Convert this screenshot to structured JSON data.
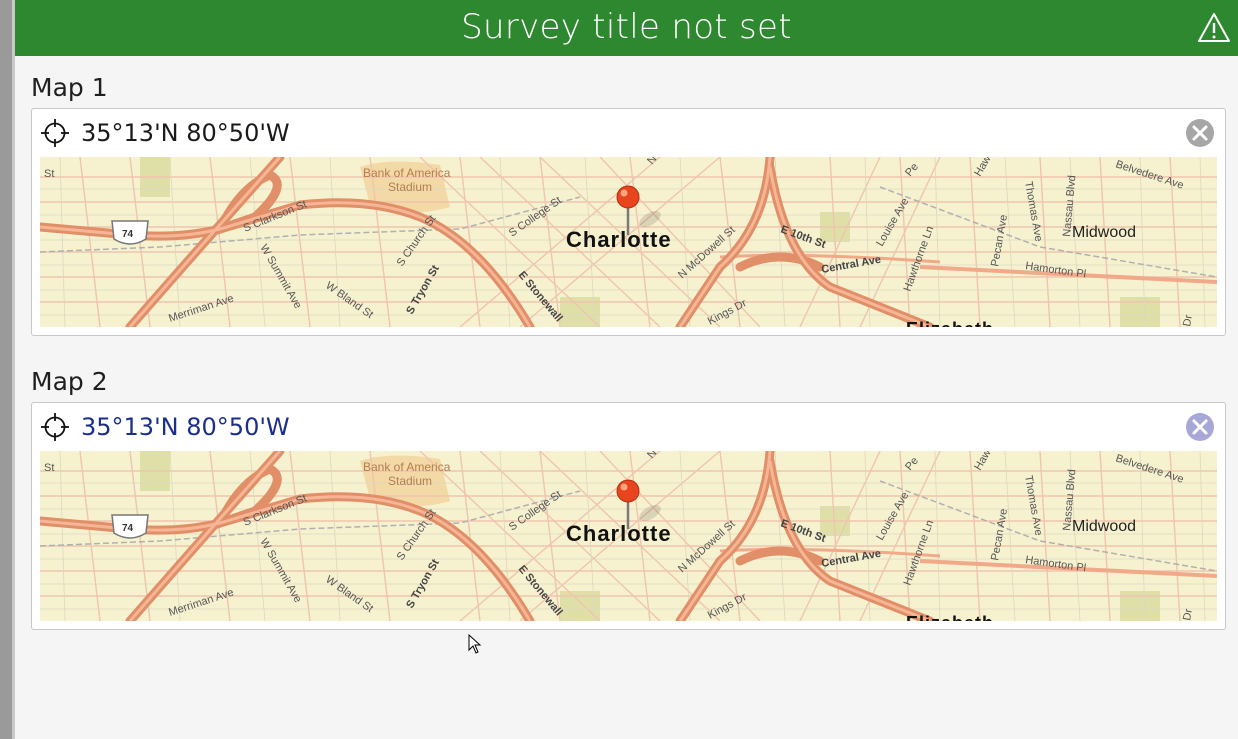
{
  "header": {
    "title": "Survey title not set",
    "warning_icon": "warning-triangle-icon"
  },
  "questions": [
    {
      "label": "Map 1",
      "coordinate": "35°13'N 80°50'W",
      "coord_color": "#1a1a1a",
      "clear_icon_color": "#a6a6a6"
    },
    {
      "label": "Map 2",
      "coordinate": "35°13'N 80°50'W",
      "coord_color": "#1b2e8c",
      "clear_icon_color": "#a8a8d8"
    }
  ],
  "map": {
    "city": "Charlotte",
    "neighborhood": "Midwood",
    "poi_line1": "Bank of America",
    "poi_line2": "Stadium",
    "shield": "74",
    "partial_label": "Elizabeth",
    "road_labels": [
      "S Clarkson St",
      "W Summit Ave",
      "W Bland St",
      "S Tryon St",
      "S Church St",
      "S College St",
      "E Stonewall",
      "N McDowell St",
      "E 10th St",
      "N Br",
      "Central Ave",
      "Louise Ave",
      "Hawthorne Ln",
      "Pecan Ave",
      "Thomas Ave",
      "Nassau Blvd",
      "Hamorton Pl",
      "Belvedere Ave",
      "Kings Dr",
      "Merriman Ave",
      "Pe",
      "Hawt",
      "Dr"
    ]
  },
  "colors": {
    "header": "#2e8830",
    "map_bg": "#f6f2cf",
    "highway": "#e08f68",
    "street": "#f2b9a0",
    "pin": "#e8441e"
  }
}
